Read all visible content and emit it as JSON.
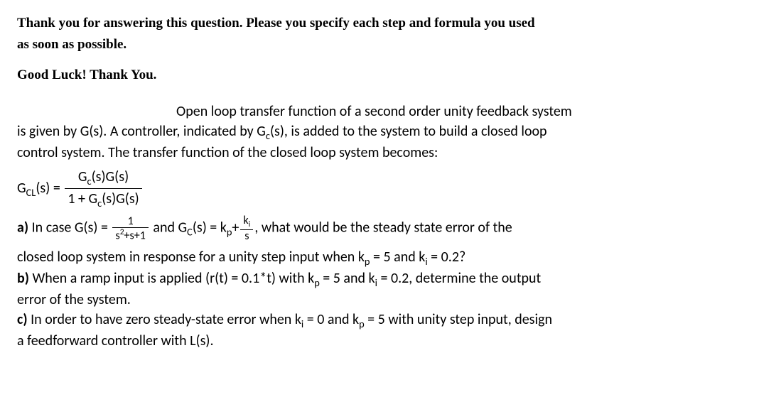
{
  "header": {
    "line1": "Thank you for answering this question. Please you specify each step and formula you used",
    "line2": "as soon as possible.",
    "goodluck": "Good Luck! Thank You."
  },
  "intro": {
    "line1": "Open loop transfer function of a second order unity feedback system",
    "line2": "is given by G(s). A controller, indicated by G",
    "line2_sub": "c",
    "line2_after": "(s), is added to the system to build a closed loop",
    "line3": "control system. The transfer function of the closed loop system becomes:"
  },
  "gcl_eq": {
    "lhs_G": "G",
    "lhs_sub": "CL",
    "lhs_tail": "(s) = ",
    "num_G1": "G",
    "num_sub1": "c",
    "num_mid": "(s)G(s)",
    "den_pre": "1 + G",
    "den_sub": "c",
    "den_tail": "(s)G(s)"
  },
  "part_a": {
    "label": "a) ",
    "t1": "In case ",
    "G_of_s": "G(s) = ",
    "frac1_num": "1",
    "frac1_den_s": "s",
    "frac1_den_exp": "2",
    "frac1_den_tail": "+s+1",
    "and": " and G",
    "c_sub": "C",
    "after_gc": "(s) = k",
    "p_sub": "p",
    "plus": "+",
    "frac2_num_k": "k",
    "frac2_num_sub": "i",
    "frac2_den": "s",
    "tail": ", what would be the steady state error of the",
    "line2_a": "closed loop system in response for a unity step input when k",
    "line2_psub": "p",
    "line2_b": " = 5 and k",
    "line2_isub": "i",
    "line2_c": " = 0.2?"
  },
  "part_b": {
    "label": "b) ",
    "t1": "When a ramp input is applied (r(t) = 0.1*t) with k",
    "psub": "p",
    "t2": " = 5 and k",
    "isub": "i",
    "t3": " = 0.2, determine the output",
    "line2": "error of the system."
  },
  "part_c": {
    "label": "c) ",
    "t1": "In order to have zero steady-state error when k",
    "isub": "i",
    "t2": " = 0 and k",
    "psub": "p",
    "t3": " = 5 with unity step input, design",
    "line2": "a feedforward controller with L(s)."
  }
}
